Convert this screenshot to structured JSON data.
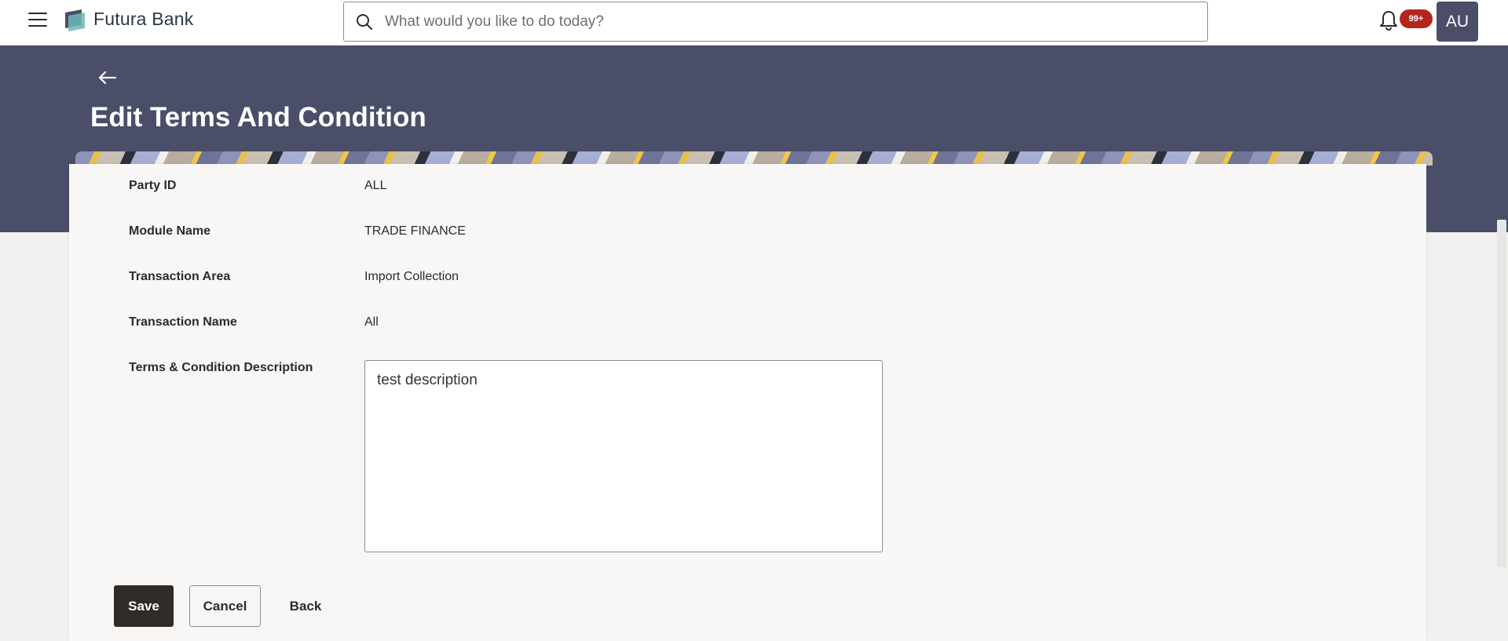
{
  "app": {
    "brand": "Futura Bank",
    "menu_icon": "hamburger-menu-icon",
    "logo_icon": "futura-bank-logo",
    "search_placeholder": "What would you like to do today?",
    "notification_icon": "bell-icon",
    "notification_count": "99+",
    "avatar_initials": "AU"
  },
  "page": {
    "back_icon": "arrow-left-icon",
    "title": "Edit Terms And Condition"
  },
  "form": {
    "fields": [
      {
        "label": "Party ID",
        "value": "ALL"
      },
      {
        "label": "Module Name",
        "value": "TRADE FINANCE"
      },
      {
        "label": "Transaction Area",
        "value": "Import Collection"
      },
      {
        "label": "Transaction Name",
        "value": "All"
      }
    ],
    "description_label": "Terms & Condition Description",
    "description_value": "test description"
  },
  "actions": {
    "save_label": "Save",
    "cancel_label": "Cancel",
    "back_label": "Back"
  },
  "colors": {
    "header_band": "#4a4e69",
    "primary_button": "#2f2b28",
    "badge": "#b3261e",
    "avatar": "#4a4e69"
  }
}
